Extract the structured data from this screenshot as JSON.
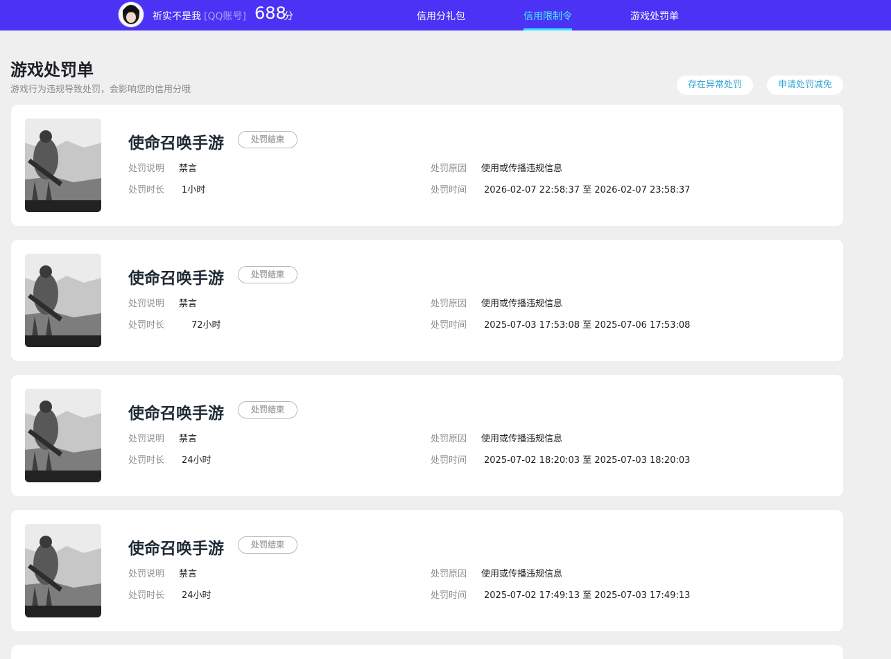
{
  "header": {
    "username": "祈实不是我",
    "account_type": "[QQ账号]",
    "score": "688",
    "score_unit": "分",
    "nav": [
      {
        "label": "信用分礼包",
        "active": false
      },
      {
        "label": "信用限制令",
        "active": true
      },
      {
        "label": "游戏处罚单",
        "active": false
      }
    ],
    "accent_color": "#4b32f5",
    "active_color": "#49f0ff"
  },
  "page": {
    "title": "游戏处罚单",
    "subtitle": "游戏行为违规导致处罚，会影响您的信用分哦",
    "buttons": [
      "存在异常处罚",
      "申请处罚减免"
    ]
  },
  "field_labels": {
    "desc": "处罚说明",
    "duration": "处罚时长",
    "reason": "处罚原因",
    "time": "处罚时间"
  },
  "penalties": [
    {
      "game": "使命召唤手游",
      "status": "处罚结束",
      "desc": "禁言",
      "duration": "1小时",
      "reason": "使用或传播违规信息",
      "time": "2026-02-07 22:58:37 至 2026-02-07 23:58:37"
    },
    {
      "game": "使命召唤手游",
      "status": "处罚结束",
      "desc": "禁言",
      "duration": "72小时",
      "reason": "使用或传播违规信息",
      "time": "2025-07-03 17:53:08 至 2025-07-06 17:53:08"
    },
    {
      "game": "使命召唤手游",
      "status": "处罚结束",
      "desc": "禁言",
      "duration": "24小时",
      "reason": "使用或传播违规信息",
      "time": "2025-07-02 18:20:03 至 2025-07-03 18:20:03"
    },
    {
      "game": "使命召唤手游",
      "status": "处罚结束",
      "desc": "禁言",
      "duration": "24小时",
      "reason": "使用或传播违规信息",
      "time": "2025-07-02 17:49:13 至 2025-07-03 17:49:13"
    }
  ]
}
